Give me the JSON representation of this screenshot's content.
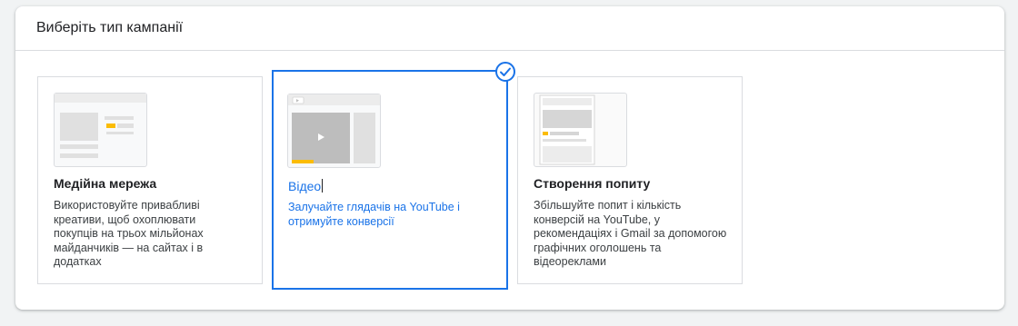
{
  "panel": {
    "title": "Виберіть тип кампанії"
  },
  "cards": [
    {
      "title": "Медійна мережа",
      "description": "Використовуйте привабливі креативи, щоб охоплювати покупців на трьох мільйонах майданчиків — на сайтах і в додатках",
      "selected": false
    },
    {
      "title": "Відео",
      "description": "Залучайте глядачів на YouTube і отримуйте конверсії",
      "selected": true
    },
    {
      "title": "Створення попиту",
      "description": "Збільшуйте попит і кількість конверсій на YouTube, у рекомендаціях і Gmail за допомогою графічних оголошень та відеореклами",
      "selected": false
    }
  ],
  "colors": {
    "accent": "#1a73e8",
    "highlight": "#fbbc04"
  }
}
